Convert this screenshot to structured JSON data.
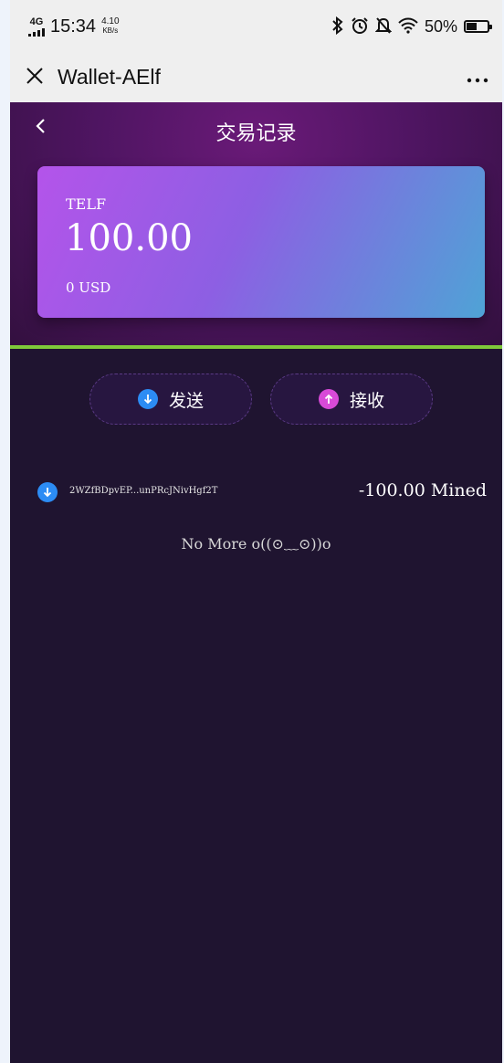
{
  "status_bar": {
    "network": "4G",
    "time": "15:34",
    "speed_value": "4.10",
    "speed_unit": "KB/s",
    "icons": [
      "bluetooth-icon",
      "alarm-icon",
      "mute-icon",
      "wifi-icon"
    ],
    "battery": "50%",
    "battery_level": 0.5
  },
  "title_bar": {
    "title": "Wallet-AElf",
    "close_icon": "close-icon",
    "more_icon": "more-icon"
  },
  "header": {
    "page_title": "交易记录",
    "back_icon": "back-icon"
  },
  "card": {
    "token": "TELF",
    "amount": "100.00",
    "usd": "0 USD"
  },
  "actions": {
    "send_label": "发送",
    "receive_label": "接收"
  },
  "transactions": [
    {
      "address": "2WZfBDpvEP...unPRcJNivHgf2T",
      "amount": "-100.00 Mined",
      "icon": "arrow-down-icon"
    }
  ],
  "list_end_text": "No More o((⊙﹏⊙))o",
  "colors": {
    "header_purple": "#4f1562",
    "body_bg": "#1f1430",
    "divider_green": "#7fc93a",
    "send_blue": "#2c8cf4",
    "receive_pink": "#d84ad8"
  }
}
